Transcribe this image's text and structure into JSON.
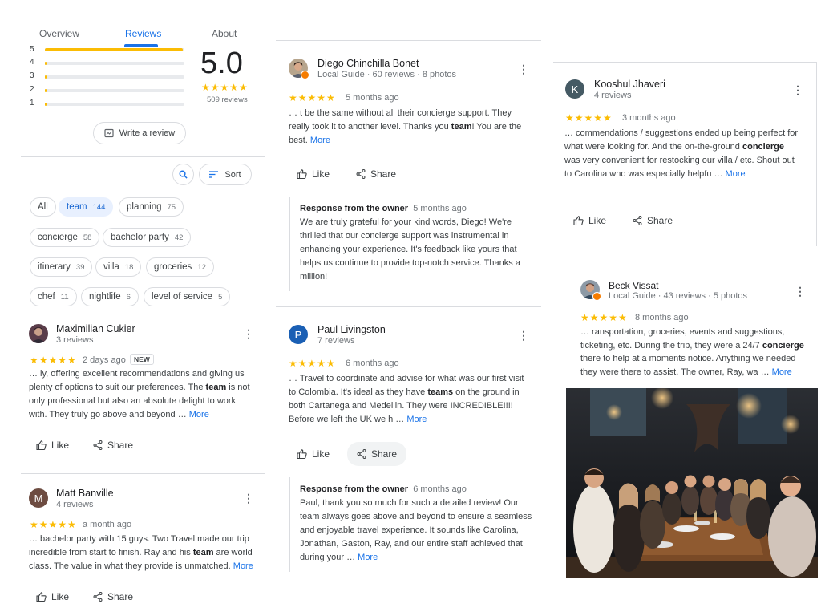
{
  "tabs": [
    {
      "label": "Overview",
      "active": false
    },
    {
      "label": "Reviews",
      "active": true
    },
    {
      "label": "About",
      "active": false
    }
  ],
  "rating": {
    "value": "5.0",
    "stars": "★★★★★",
    "count_label": "509 reviews",
    "rows": [
      {
        "label": "5",
        "fraction": 0.99
      },
      {
        "label": "4",
        "fraction": 0.01
      },
      {
        "label": "3",
        "fraction": 0.01
      },
      {
        "label": "2",
        "fraction": 0.01
      },
      {
        "label": "1",
        "fraction": 0.01
      }
    ]
  },
  "write_review_label": "Write a review",
  "sort_label": "Sort",
  "chips": [
    {
      "label": "All",
      "count": ""
    },
    {
      "label": "team",
      "count": "144",
      "selected": true
    },
    {
      "label": "planning",
      "count": "75"
    },
    {
      "label": "concierge",
      "count": "58"
    },
    {
      "label": "bachelor party",
      "count": "42"
    },
    {
      "label": "itinerary",
      "count": "39"
    },
    {
      "label": "villa",
      "count": "18"
    },
    {
      "label": "groceries",
      "count": "12"
    },
    {
      "label": "chef",
      "count": "11"
    },
    {
      "label": "nightlife",
      "count": "6"
    },
    {
      "label": "level of service",
      "count": "5"
    }
  ],
  "actions": {
    "like": "Like",
    "share": "Share",
    "more": "More",
    "new_badge": "NEW"
  },
  "reviews": {
    "maximilian": {
      "name": "Maximilian Cukier",
      "meta": "3 reviews",
      "stars": "★★★★★",
      "time": "2 days ago",
      "p1": "… ly, offering excellent recommendations and giving us plenty of options to suit our preferences. The ",
      "k1": "team",
      "p2": " is not only professional but also an absolute delight to work with. They truly go above and beyond  … "
    },
    "matt": {
      "name": "Matt Banville",
      "initial": "M",
      "meta": "4 reviews",
      "stars": "★★★★★",
      "time": "a month ago",
      "p1": "… bachelor party with 15 guys. Two Travel made our trip incredible from start to finish. Ray and his ",
      "k1": "team",
      "p2": " are world class. The value in what they provide is unmatched. "
    },
    "diego": {
      "name": "Diego Chinchilla Bonet",
      "meta": "Local Guide · 60 reviews · 8 photos",
      "stars": "★★★★★",
      "time": "5 months ago",
      "p1": "… t be the same without all their concierge support. They really took it to another level. Thanks you ",
      "k1": "team",
      "p2": "! You are the best. ",
      "owner_title": "Response from the owner",
      "owner_time": "5 months ago",
      "owner_text": "We are truly grateful for your kind words, Diego! We're thrilled that our concierge support was instrumental in enhancing your experience. It's feedback like yours that helps us continue to provide top-notch service. Thanks a million!"
    },
    "paul": {
      "name": "Paul Livingston",
      "initial": "P",
      "meta": "7 reviews",
      "stars": "★★★★★",
      "time": "6 months ago",
      "p1": "… Travel to coordinate and advise for what was our first visit to Colombia.  It's ideal as they have ",
      "k1": "teams",
      "p2": " on the ground in both Cartanega and Medellin.  They were INCREDIBLE!!!! Before we left the UK we h  … ",
      "owner_title": "Response from the owner",
      "owner_time": "6 months ago",
      "owner_text": "Paul, thank you so much for such a detailed review! Our team always goes above and beyond to ensure a seamless and enjoyable travel experience. It sounds like Carolina, Jonathan, Gaston, Ray, and our entire staff achieved that during your … "
    },
    "kooshul": {
      "name": "Kooshul Jhaveri",
      "initial": "K",
      "meta": "4 reviews",
      "stars": "★★★★★",
      "time": "3 months ago",
      "p1": "… commendations / suggestions ended up being perfect for what were looking for. And the on-the-ground ",
      "k1": "concierge",
      "p2": " was very convenient for restocking our villa / etc. Shout out to Carolina who was especially helpfu … "
    },
    "beck": {
      "name": "Beck Vissat",
      "meta": "Local Guide · 43 reviews · 5 photos",
      "stars": "★★★★★",
      "time": "8 months ago",
      "p1": "… ransportation, groceries, events and suggestions, ticketing, etc. During the trip, they were a 24/7 ",
      "k1": "concierge",
      "p2": " there to help at a moments notice. Anything we needed they were there to assist. The owner, Ray, wa … "
    }
  },
  "colors": {
    "accent": "#1a73e8",
    "star": "#fbbc04",
    "chip_selected_bg": "#e8f0fe"
  }
}
